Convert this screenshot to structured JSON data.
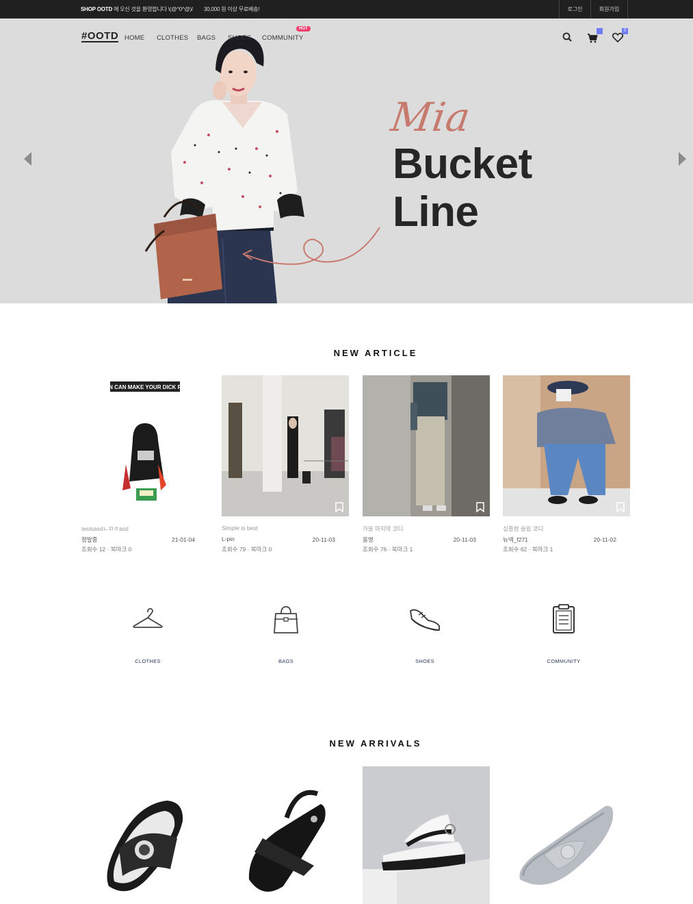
{
  "topbar": {
    "brand": "SHOP OOTD",
    "welcome": "에 오신 것을 환영합니다 \\(@^0^@)/",
    "shipping": "30,000 원 이상 무료배송!",
    "login": "로그인",
    "join": "회원가입"
  },
  "nav": {
    "logo": "#OOTD",
    "items": [
      "HOME",
      "CLOTHES",
      "BAGS",
      "SHOES",
      "COMMUNITY"
    ],
    "hot_badge": "HOT",
    "cart_count": "",
    "wishlist_count": "0",
    "icons": [
      "search-icon",
      "cart-icon",
      "heart-icon"
    ]
  },
  "hero": {
    "script": "Mia",
    "line1": "Bucket",
    "line2": "Line",
    "accent_color": "#c77a6e"
  },
  "new_article": {
    "title": "NEW ARTICLE",
    "cards": [
      {
        "title": "testsasdㄴㅁㅇasd",
        "author": "정발중",
        "date": "21-01-04",
        "stats": "조회수 12 · 북마크 0",
        "caption": "GLUTEN CAN MAKE YOUR DICK FLY OFF"
      },
      {
        "title": "Simple is best",
        "author": "L-pin",
        "date": "20-11-03",
        "stats": "조회수 79 · 북마크 0"
      },
      {
        "title": "가을 마지막 코디",
        "author": "옹영",
        "date": "20-11-03",
        "stats": "조회수 76 · 북마크 1"
      },
      {
        "title": "심플한 슬림 코디",
        "author": "뉴넥_f271",
        "date": "20-11-02",
        "stats": "조회수 62 · 북마크 1"
      }
    ]
  },
  "categories": [
    {
      "label": "CLOTHES",
      "icon": "hanger-icon"
    },
    {
      "label": "BAGS",
      "icon": "bag-icon"
    },
    {
      "label": "SHOES",
      "icon": "sneaker-icon"
    },
    {
      "label": "COMMUNITY",
      "icon": "clipboard-icon"
    }
  ],
  "new_arrivals": {
    "title": "NEW ARRIVALS"
  }
}
